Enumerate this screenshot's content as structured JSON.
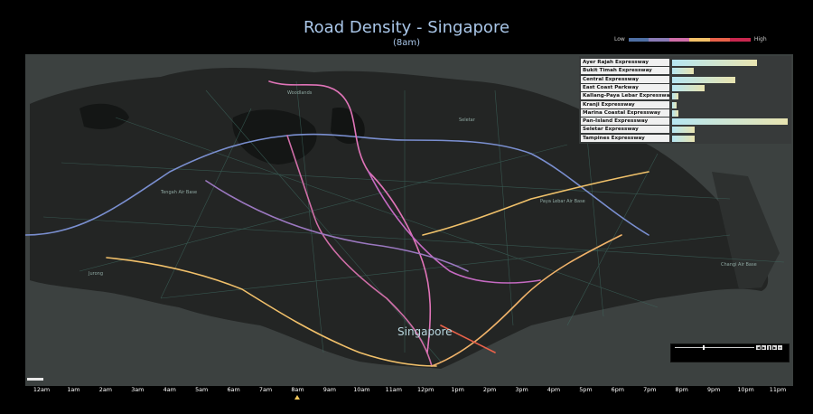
{
  "title": "Road Density - Singapore",
  "subtitle": "(8am)",
  "legend": {
    "low_label": "Low",
    "high_label": "High",
    "colors": [
      "#4e6fa4",
      "#8a7bb6",
      "#d06ea8",
      "#f3c169",
      "#e9624a",
      "#c9274e"
    ]
  },
  "chart_data": {
    "type": "bar",
    "categories": [
      "Ayer Rajah Expressway",
      "Bukit Timah Expressway",
      "Central Expressway",
      "East Coast Parkway",
      "Kallang-Paya Lebar Expressway",
      "Kranji Expressway",
      "Marina Coastal Expressway",
      "Pan-Island Expressway",
      "Seletar Expressway",
      "Tampines Expressway"
    ],
    "values": [
      94,
      24,
      70,
      36,
      7,
      5,
      7,
      128,
      25,
      25
    ],
    "xlim": [
      0,
      130
    ]
  },
  "map": {
    "city_label": "Singapore",
    "places": [
      {
        "name": "Paya Lebar Air Base"
      },
      {
        "name": "Changi Air Base"
      },
      {
        "name": "Tengah Air Base"
      },
      {
        "name": "Seletar"
      },
      {
        "name": "Jurong"
      },
      {
        "name": "Woodlands"
      }
    ]
  },
  "timeline": {
    "hours": [
      "12am",
      "1am",
      "2am",
      "3am",
      "4am",
      "5am",
      "6am",
      "7am",
      "8am",
      "9am",
      "10am",
      "11am",
      "12pm",
      "1pm",
      "2pm",
      "3pm",
      "4pm",
      "5pm",
      "6pm",
      "7pm",
      "8pm",
      "9pm",
      "10pm",
      "11pm"
    ],
    "selected_index": 8
  },
  "player": {
    "position": 0.35
  }
}
